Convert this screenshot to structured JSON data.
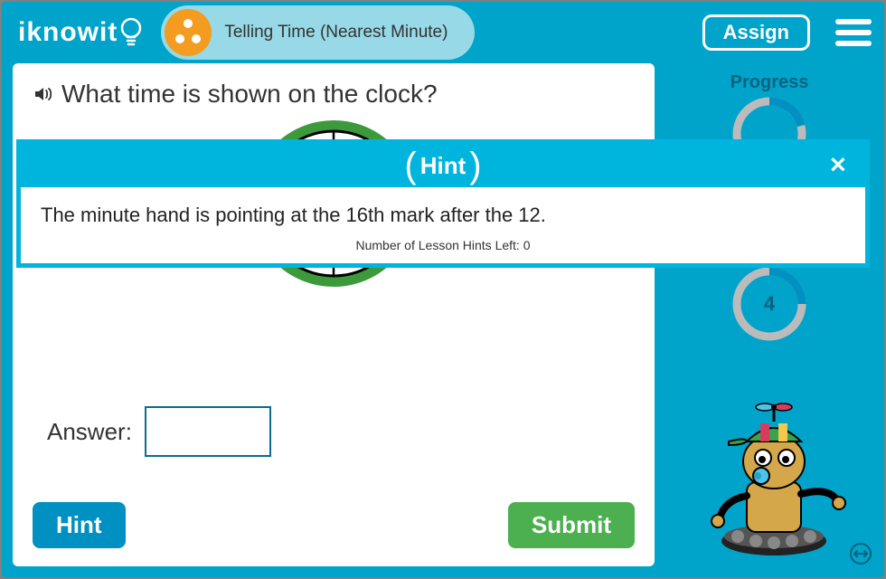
{
  "header": {
    "logo_text": "iknowit",
    "lesson_title": "Telling Time (Nearest Minute)",
    "assign_label": "Assign"
  },
  "question": {
    "text": "What time is shown on the clock?",
    "answer_label": "Answer:",
    "answer_value": ""
  },
  "buttons": {
    "hint_label": "Hint",
    "submit_label": "Submit"
  },
  "sidebar": {
    "progress_label": "Progress",
    "progress_value": "",
    "score_value": "4"
  },
  "modal": {
    "title": "Hint",
    "body": "The minute hand is pointing at the 16th mark after the 12.",
    "hints_left_text": "Number of Lesson Hints Left: 0"
  },
  "colors": {
    "brand": "#00a3c9",
    "hint": "#00b5dd",
    "progress": "#09637f",
    "submit": "#4caf50",
    "badge": "#f39c1f"
  }
}
